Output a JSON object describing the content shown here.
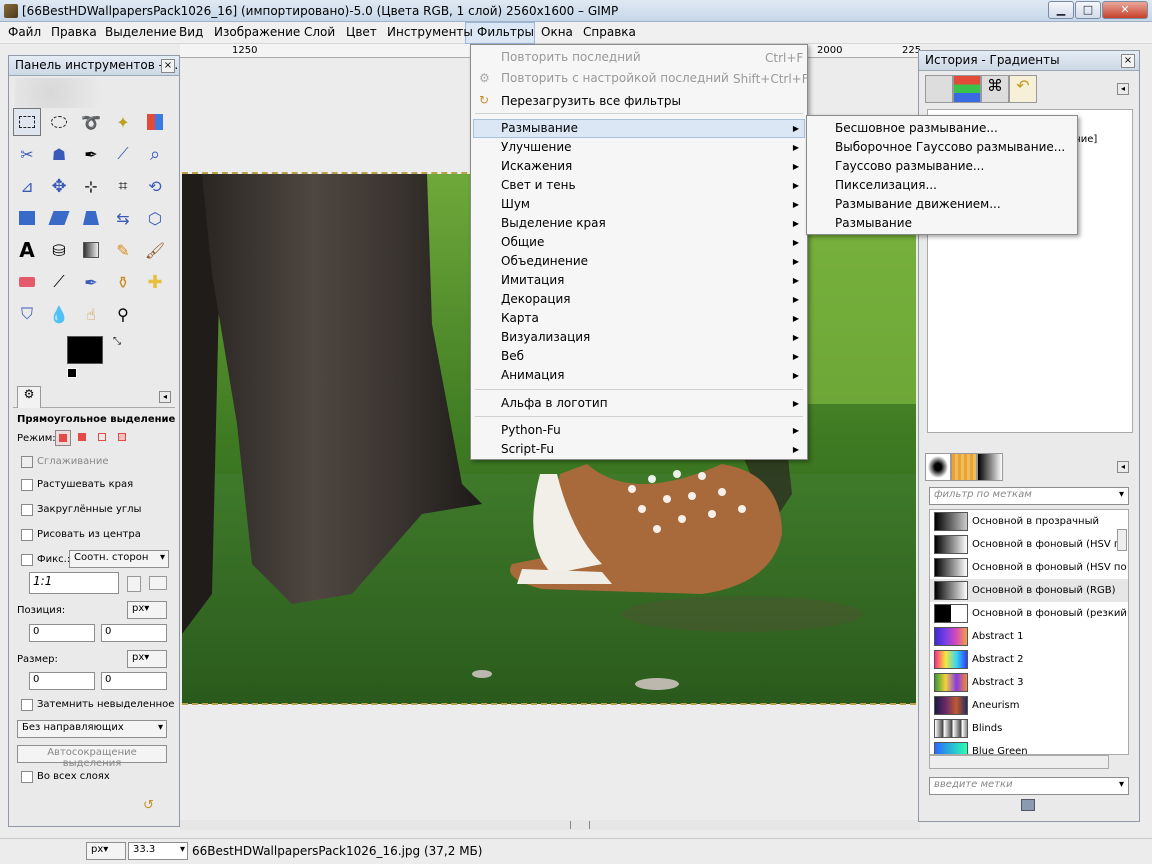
{
  "window": {
    "title": "[66BestHDWallpapersPack1026_16] (импортировано)-5.0 (Цвета RGB, 1 слой) 2560x1600 – GIMP",
    "min": "▁",
    "max": "□",
    "close": "✕"
  },
  "menubar": [
    "Файл",
    "Правка",
    "Выделение",
    "Вид",
    "Изображение",
    "Слой",
    "Цвет",
    "Инструменты",
    "Фильтры",
    "Окна",
    "Справка"
  ],
  "ruler": {
    "t1": "1250",
    "t2": "2000",
    "t3": "225"
  },
  "filters_menu": {
    "repeat_last": "Повторить последний",
    "repeat_last_key": "Ctrl+F",
    "reshow_last": "Повторить с настройкой последний",
    "reshow_last_key": "Shift+Ctrl+F",
    "reset_all": "Перезагрузить все фильтры",
    "groups": [
      "Размывание",
      "Улучшение",
      "Искажения",
      "Свет и тень",
      "Шум",
      "Выделение края",
      "Общие",
      "Объединение",
      "Имитация",
      "Декорация",
      "Карта",
      "Визуализация",
      "Веб",
      "Анимация"
    ],
    "alpha_to_logo": "Альфа в логотип",
    "python_fu": "Python-Fu",
    "script_fu": "Script-Fu"
  },
  "blur_submenu": [
    "Бесшовное размывание...",
    "Выборочное Гауссово размывание...",
    "Гауссово размывание...",
    "Пикселизация...",
    "Размывание движением...",
    "Размывание"
  ],
  "toolbox": {
    "title": "Панель инструментов - ...",
    "tool_name": "Прямоугольное выделение",
    "mode_label": "Режим:",
    "antialias": "Сглаживание",
    "feather": "Растушевать края",
    "rounded": "Закруглённые углы",
    "from_center": "Рисовать из центра",
    "fixed": "Фикс.:",
    "fixed_option": "Соотн. сторон",
    "ratio": "1:1",
    "position_label": "Позиция:",
    "size_label": "Размер:",
    "unit": "px",
    "pos_x": "0",
    "pos_y": "0",
    "size_w": "0",
    "size_h": "0",
    "highlight": "Затемнить невыделенное",
    "guides": "Без направляющих",
    "autoshrink": "Автосокращение выделения",
    "all_layers": "Во всех слоях"
  },
  "dock": {
    "title": "История - Градиенты",
    "history_partial": "ение]",
    "filter_placeholder": "фильтр по меткам",
    "tags_placeholder": "введите метки",
    "gradients": [
      {
        "name": "Основной в прозрачный",
        "css": "linear-gradient(90deg,#000,rgba(0,0,0,0))"
      },
      {
        "name": "Основной в фоновый  (HSV п",
        "css": "linear-gradient(90deg,#000,#fff)"
      },
      {
        "name": "Основной в фоновый  (HSV по",
        "css": "linear-gradient(90deg,#000,#fff)"
      },
      {
        "name": "Основной в фоновый (RGB)",
        "css": "linear-gradient(90deg,#000,#fff)"
      },
      {
        "name": "Основной в фоновый (резкий",
        "css": "linear-gradient(90deg,#000 50%,#fff 50%)"
      },
      {
        "name": "Abstract 1",
        "css": "linear-gradient(90deg,#3a2bd6,#7b3fe4,#d84ab8,#f0a040)"
      },
      {
        "name": "Abstract 2",
        "css": "linear-gradient(90deg,#ff2a8a,#f6e83a,#3ad6f0,#2a40ff)"
      },
      {
        "name": "Abstract 3",
        "css": "linear-gradient(90deg,#3a9a3a,#f4d23a,#8a3ae0,#f08a3a)"
      },
      {
        "name": "Aneurism",
        "css": "linear-gradient(90deg,#1a1a40,#6a2a6a,#c05a30,#2a2a60)"
      },
      {
        "name": "Blinds",
        "css": "repeating-linear-gradient(90deg,#fff 0,#444 8px,#fff 9px)"
      },
      {
        "name": "Blue Green",
        "css": "linear-gradient(90deg,#2a6aff,#2affb0)"
      }
    ]
  },
  "status": {
    "unit": "px",
    "zoom": "33.3",
    "file": "66BestHDWallpapersPack1026_16.jpg (37,2 МБ)"
  },
  "colors": {
    "menu_highlight": "#dbe7f4",
    "title_bar": "#cdd9e6",
    "panel_bg": "#eaeaea"
  }
}
